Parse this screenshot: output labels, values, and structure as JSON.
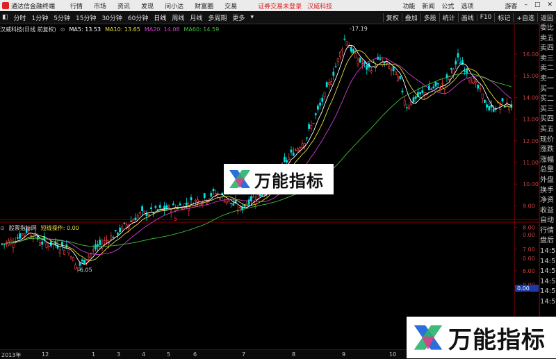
{
  "menubar": {
    "app_title": "通达信金融终端",
    "items": [
      "行情",
      "市场",
      "资讯",
      "发现",
      "问小达",
      "财富圈",
      "交易"
    ],
    "warning": "证券交易未登录",
    "stock": "汉威科技",
    "right_items": [
      "功能",
      "新闻",
      "公式",
      "选项"
    ],
    "guest": "游客"
  },
  "toolbar": {
    "periods": [
      "分时",
      "1分钟",
      "5分钟",
      "15分钟",
      "30分钟",
      "60分钟",
      "日线",
      "周线",
      "月线",
      "多周期",
      "更多"
    ],
    "right_buttons": [
      "复权",
      "叠加",
      "多股",
      "统计",
      "画线",
      "F10",
      "标记",
      "+自选",
      "返回"
    ]
  },
  "legend": {
    "title": "汉威科技(日线 前复权)",
    "ma5": "MA5: 13.53",
    "ma10": "MA10: 13.65",
    "ma20": "MA20: 14.08",
    "ma60": "MA60: 14.59"
  },
  "price_axis": [
    "16.00",
    "15.00",
    "14.00",
    "13.00",
    "12.00",
    "11.00",
    "10.00",
    "9.00",
    "8.00",
    "7.00",
    "6.00"
  ],
  "annotations": {
    "high": "17.19",
    "low": "6.05",
    "marker": "5"
  },
  "indicator": {
    "name": "股票指标网",
    "label": "短线操作: 0.00"
  },
  "indicator_axis": [
    "0.00",
    "0.00",
    "0.00"
  ],
  "right_panel": [
    "委比",
    "卖五",
    "卖四",
    "卖三",
    "卖二",
    "卖一",
    "买一",
    "买二",
    "买三",
    "买四",
    "买五",
    "现价",
    "涨跌",
    "涨幅",
    "总量",
    "外盘",
    "换手",
    "净资",
    "收益",
    "自动",
    "行情",
    "盘后",
    "14:56",
    "14:56",
    "14:56",
    "14:56",
    "14:56",
    "14:56"
  ],
  "time_axis": [
    "2013年",
    "12",
    "1",
    "3",
    "4",
    "5",
    "6",
    "7",
    "8",
    "9",
    "10",
    "11"
  ],
  "watermark": "万能指标",
  "colors": {
    "up": "#ff4040",
    "down": "#00e0e0",
    "ma5": "#ffffff",
    "ma10": "#e8e040",
    "ma20": "#d040d0",
    "ma60": "#40c040",
    "accent": "#d22"
  }
}
